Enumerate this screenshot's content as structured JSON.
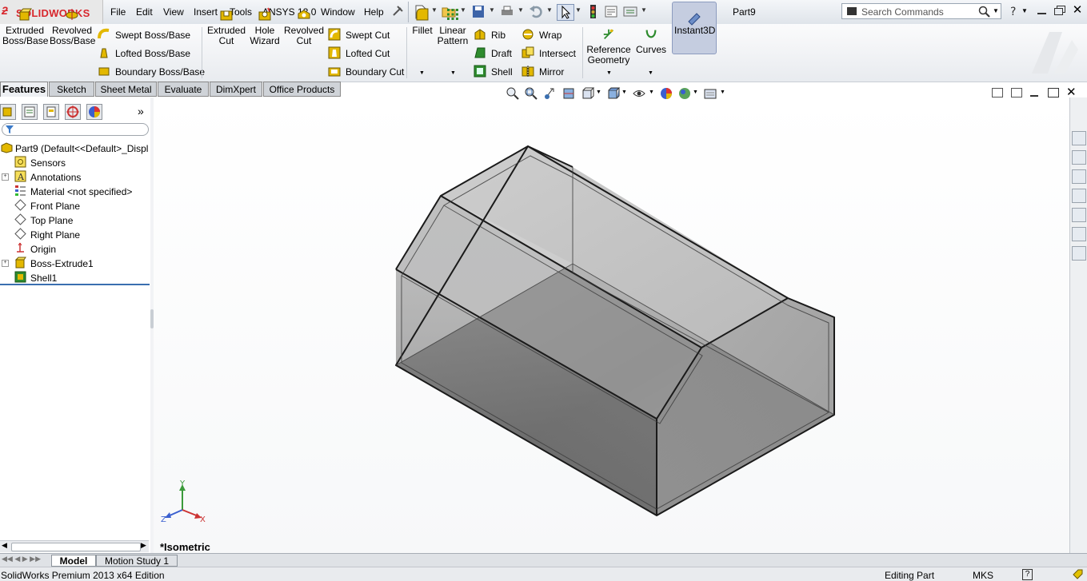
{
  "app": {
    "brand": "SOLIDWORKS",
    "document_name": "Part9",
    "search_placeholder": "Search Commands",
    "menus": [
      "File",
      "Edit",
      "View",
      "Insert",
      "Tools",
      "ANSYS 13.0",
      "Window",
      "Help"
    ]
  },
  "toolbar": {
    "boss_group": [
      {
        "label1": "Extruded",
        "label2": "Boss/Base",
        "icon": "extruded-boss-icon"
      },
      {
        "label1": "Revolved",
        "label2": "Boss/Base",
        "icon": "revolved-boss-icon"
      }
    ],
    "boss_small": [
      "Swept Boss/Base",
      "Lofted Boss/Base",
      "Boundary Boss/Base"
    ],
    "cut_group": [
      {
        "label1": "Extruded",
        "label2": "Cut",
        "icon": "extruded-cut-icon"
      },
      {
        "label1": "Hole",
        "label2": "Wizard",
        "icon": "hole-wizard-icon"
      },
      {
        "label1": "Revolved",
        "label2": "Cut",
        "icon": "revolved-cut-icon"
      }
    ],
    "cut_small": [
      "Swept Cut",
      "Lofted Cut",
      "Boundary Cut"
    ],
    "fillet": "Fillet",
    "linear_pattern": {
      "label1": "Linear",
      "label2": "Pattern"
    },
    "features_small_a": [
      "Rib",
      "Draft",
      "Shell"
    ],
    "features_small_b": [
      "Wrap",
      "Intersect",
      "Mirror"
    ],
    "reference_geometry": {
      "label1": "Reference",
      "label2": "Geometry"
    },
    "curves": "Curves",
    "instant3d": "Instant3D"
  },
  "tabs": [
    "Features",
    "Sketch",
    "Sheet Metal",
    "Evaluate",
    "DimXpert",
    "Office Products"
  ],
  "active_tab": "Features",
  "feature_tree": {
    "root": "Part9  (Default<<Default>_Displ",
    "items": [
      {
        "label": "Sensors",
        "icon": "sensor-icon",
        "expandable": false
      },
      {
        "label": "Annotations",
        "icon": "annotations-icon",
        "expandable": true
      },
      {
        "label": "Material <not specified>",
        "icon": "material-icon",
        "expandable": false
      },
      {
        "label": "Front Plane",
        "icon": "plane-icon",
        "expandable": false
      },
      {
        "label": "Top Plane",
        "icon": "plane-icon",
        "expandable": false
      },
      {
        "label": "Right Plane",
        "icon": "plane-icon",
        "expandable": false
      },
      {
        "label": "Origin",
        "icon": "origin-icon",
        "expandable": false
      },
      {
        "label": "Boss-Extrude1",
        "icon": "boss-extrude-icon",
        "expandable": true
      },
      {
        "label": "Shell1",
        "icon": "shell-icon",
        "expandable": false
      }
    ]
  },
  "viewport": {
    "view_label": "*Isometric",
    "triad_axes": [
      "Y",
      "X",
      "Z"
    ]
  },
  "bottom_tabs": [
    "Model",
    "Motion Study 1"
  ],
  "status": {
    "edition": "SolidWorks Premium 2013 x64 Edition",
    "mode": "Editing Part",
    "units": "MKS",
    "help": "?"
  },
  "colors": {
    "brand_red": "#d8262c",
    "active_tab_bg": "#eef0f3",
    "instant3d_bg": "#c5cde0",
    "model_edge": "#1a1a1a"
  }
}
